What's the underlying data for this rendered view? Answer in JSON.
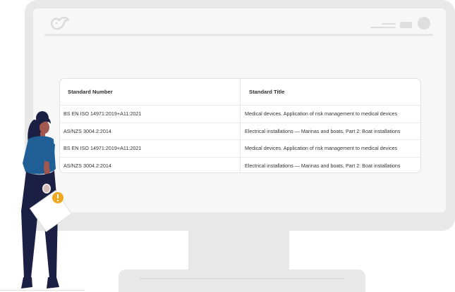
{
  "table": {
    "headers": {
      "standard_number": "Standard Number",
      "standard_title": "Standard Title"
    },
    "rows": [
      {
        "number": "BS EN ISO 14971:2019+A11:2021",
        "title": "Medical devices. Application of risk management to medical devices"
      },
      {
        "number": "AS/NZS 3004.2:2014",
        "title": "Electrical installations — Marinas and boats, Part 2: Boat installations"
      },
      {
        "number": "BS EN ISO 14971:2019+A11:2021",
        "title": "Medical devices. Application of risk management to medical devices"
      },
      {
        "number": "AS/NZS 3004.2:2014",
        "title": "Electrical installations — Marinas and boats, Part 2: Boat installations"
      }
    ]
  },
  "icons": {
    "logo": "bird-logo-icon",
    "menu": "menu-lines-icon",
    "window": "window-button-icon",
    "avatar": "avatar-icon",
    "alert": "exclamation-icon"
  },
  "colors": {
    "frame": "#e8e8e8",
    "screen": "#f7f7f7",
    "shirt": "#1f5f96",
    "pants": "#1c1f44",
    "hair": "#1c1f44",
    "skin": "#a2584f",
    "alert": "#f0a820"
  }
}
